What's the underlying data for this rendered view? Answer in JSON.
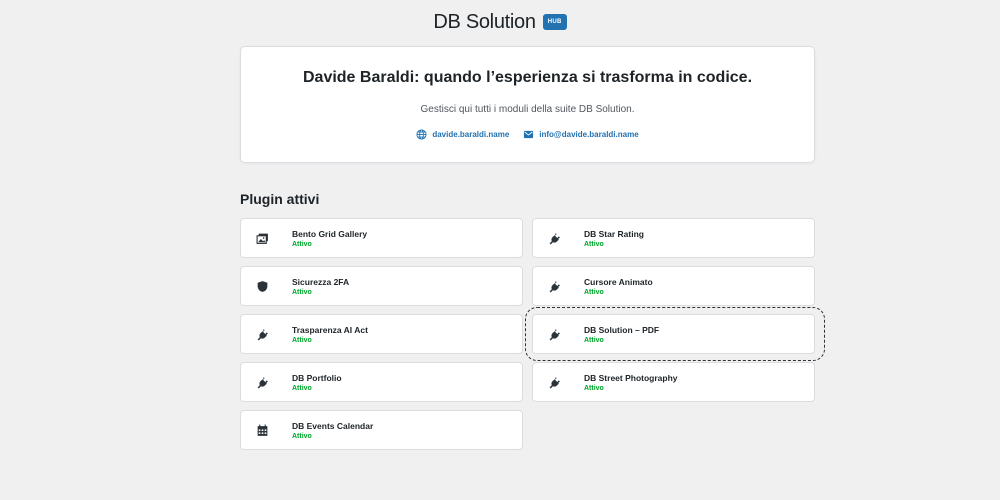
{
  "header": {
    "title": "DB Solution",
    "badge": "HUB"
  },
  "hero": {
    "title": "Davide Baraldi: quando l’esperienza si trasforma in codice.",
    "subtitle": "Gestisci qui tutti i moduli della suite DB Solution.",
    "website": {
      "label": "davide.baraldi.name",
      "icon": "globe-icon"
    },
    "email": {
      "label": "info@davide.baraldi.name",
      "icon": "mail-icon"
    }
  },
  "section_title": "Plugin attivi",
  "plugins": [
    {
      "name": "Bento Grid Gallery",
      "status": "Attivo",
      "icon": "gallery-icon"
    },
    {
      "name": "DB Star Rating",
      "status": "Attivo",
      "icon": "plugin-icon"
    },
    {
      "name": "Sicurezza 2FA",
      "status": "Attivo",
      "icon": "shield-icon"
    },
    {
      "name": "Cursore Animato",
      "status": "Attivo",
      "icon": "plugin-icon"
    },
    {
      "name": "Trasparenza AI Act",
      "status": "Attivo",
      "icon": "plugin-icon"
    },
    {
      "name": "DB Solution – PDF",
      "status": "Attivo",
      "icon": "plugin-icon"
    },
    {
      "name": "DB Portfolio",
      "status": "Attivo",
      "icon": "plugin-icon"
    },
    {
      "name": "DB Street Photography",
      "status": "Attivo",
      "icon": "plugin-icon"
    },
    {
      "name": "DB Events Calendar",
      "status": "Attivo",
      "icon": "calendar-icon"
    }
  ],
  "colors": {
    "accent": "#2271b1",
    "active": "#00a32a",
    "background": "#f0f0f1"
  }
}
